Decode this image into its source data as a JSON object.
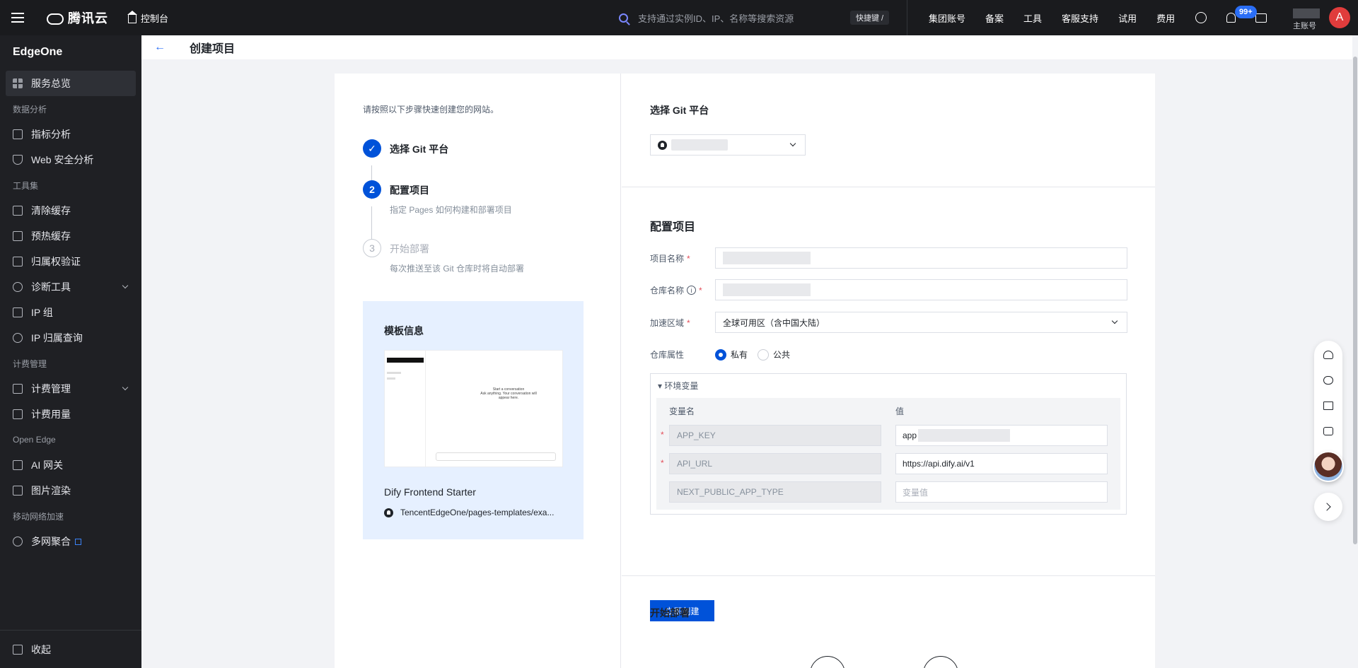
{
  "topbar": {
    "brand": "腾讯云",
    "console": "控制台",
    "search_placeholder": "支持通过实例ID、IP、名称等搜索资源",
    "shortcut": "快捷键 /",
    "links": [
      "集团账号",
      "备案",
      "工具",
      "客服支持",
      "试用",
      "费用"
    ],
    "notifications": "99+",
    "account_label": "主账号",
    "avatar_letter": "A"
  },
  "sidebar": {
    "title": "EdgeOne",
    "overview": "服务总览",
    "groups": [
      {
        "label": "数据分析",
        "items": [
          "指标分析",
          "Web 安全分析"
        ]
      },
      {
        "label": "工具集",
        "items": [
          "清除缓存",
          "预热缓存",
          "归属权验证",
          "诊断工具",
          "IP 组",
          "IP 归属查询"
        ]
      },
      {
        "label": "计费管理",
        "items": [
          "计费管理",
          "计费用量"
        ]
      },
      {
        "label": "Open Edge",
        "items": [
          "AI 网关",
          "图片渲染"
        ]
      },
      {
        "label": "移动网络加速",
        "items": [
          "多网聚合"
        ]
      }
    ],
    "collapse": "收起"
  },
  "page": {
    "back": "←",
    "title": "创建项目"
  },
  "steps": {
    "intro": "请按照以下步骤快速创建您的网站。",
    "items": [
      {
        "num": "✓",
        "title": "选择 Git 平台",
        "desc": ""
      },
      {
        "num": "2",
        "title": "配置项目",
        "desc": "指定 Pages 如何构建和部署项目"
      },
      {
        "num": "3",
        "title": "开始部署",
        "desc": "每次推送至该 Git 仓库时将自动部署"
      }
    ]
  },
  "template": {
    "title": "模板信息",
    "name": "Dify Frontend Starter",
    "repo": "TencentEdgeOne/pages-templates/exa...",
    "preview_heading": "Start a conversation",
    "preview_sub": "Ask anything. Your conversation will appear here."
  },
  "git_section": {
    "title": "选择 Git 平台"
  },
  "config": {
    "title": "配置项目",
    "project_name_label": "项目名称",
    "repo_name_label": "仓库名称",
    "region_label": "加速区域",
    "region_value": "全球可用区（含中国大陆）",
    "repo_type_label": "仓库属性",
    "private": "私有",
    "public": "公共",
    "env_title": "▾ 环境变量",
    "env_col_name": "变量名",
    "env_col_value": "值",
    "env_rows": [
      {
        "key": "APP_KEY",
        "value": "app",
        "required": true
      },
      {
        "key": "API_URL",
        "value": "https://api.dify.ai/v1",
        "required": true
      },
      {
        "key": "NEXT_PUBLIC_APP_TYPE",
        "value": "",
        "placeholder": "变量值",
        "required": false
      }
    ],
    "submit": "立即创建"
  },
  "deploy_section": {
    "title": "开始部署"
  }
}
